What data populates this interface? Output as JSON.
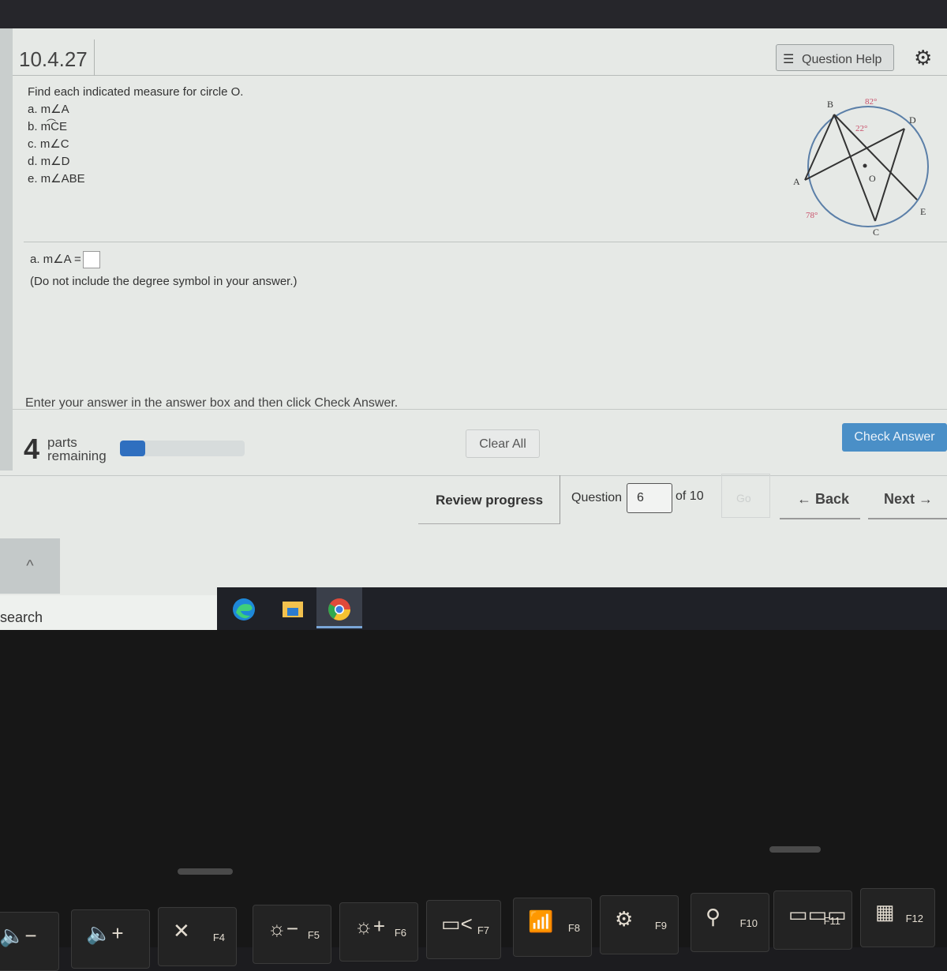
{
  "header": {
    "question_id": "10.4.27",
    "question_help_label": "Question Help",
    "question_help_icon": "list-icon",
    "settings_icon": "gear-icon"
  },
  "problem": {
    "prompt": "Find each indicated measure for circle O.",
    "items": [
      "a. m∠A",
      "b. mCE",
      "c. m∠C",
      "d. m∠D",
      "e. m∠ABE"
    ],
    "arc_item_index": 1
  },
  "diagram": {
    "points": [
      "A",
      "B",
      "C",
      "D",
      "E",
      "O"
    ],
    "arc_BD": "82°",
    "angle_DBE": "22°",
    "arc_AC": "78°",
    "label_color": "#c9506a",
    "circle_color": "#5b7fa8"
  },
  "answer": {
    "label": "a. m∠A =",
    "value": "",
    "note": "(Do not include the degree symbol in your answer.)"
  },
  "instructions": "Enter your answer in the answer box and then click Check Answer.",
  "status": {
    "parts_remaining_count": "4",
    "parts_remaining_label_1": "parts",
    "parts_remaining_label_2": "remaining",
    "progress_fraction": 0.2,
    "progress_color": "#2f6fbf"
  },
  "buttons": {
    "clear_all": "Clear All",
    "check_answer": "Check Answer",
    "check_answer_color": "#4a8fc7"
  },
  "navigation": {
    "review_progress": "Review progress",
    "question_label": "Question",
    "question_value": "6",
    "of_total": "of 10",
    "go": "Go",
    "back": "← Back",
    "next": "Next →"
  },
  "os": {
    "scroll_up_icon": "chevron-up-icon",
    "search_label": "search",
    "taskbar_apps": [
      "edge-icon",
      "file-explorer-icon",
      "chrome-icon"
    ],
    "active_app": "chrome-icon"
  },
  "keyboard": {
    "keys": [
      {
        "icon": "volume-down-icon",
        "glyph": "🔈−",
        "fn": ""
      },
      {
        "icon": "volume-up-icon",
        "glyph": "🔈+",
        "fn": ""
      },
      {
        "icon": "mic-mute-icon",
        "glyph": "✕",
        "fn": "F4"
      },
      {
        "icon": "brightness-down-icon",
        "glyph": "☼−",
        "fn": "F5"
      },
      {
        "icon": "brightness-up-icon",
        "glyph": "☼+",
        "fn": "F6"
      },
      {
        "icon": "display-switch-icon",
        "glyph": "▭<",
        "fn": "F7"
      },
      {
        "icon": "wireless-off-icon",
        "glyph": "📶",
        "fn": "F8"
      },
      {
        "icon": "settings-icon",
        "glyph": "⚙",
        "fn": "F9"
      },
      {
        "icon": "search-icon",
        "glyph": "⚲",
        "fn": "F10"
      },
      {
        "icon": "window-layout-icon",
        "glyph": "▭▭▭",
        "fn": "F11"
      },
      {
        "icon": "apps-grid-icon",
        "glyph": "▦",
        "fn": "F12"
      }
    ]
  }
}
